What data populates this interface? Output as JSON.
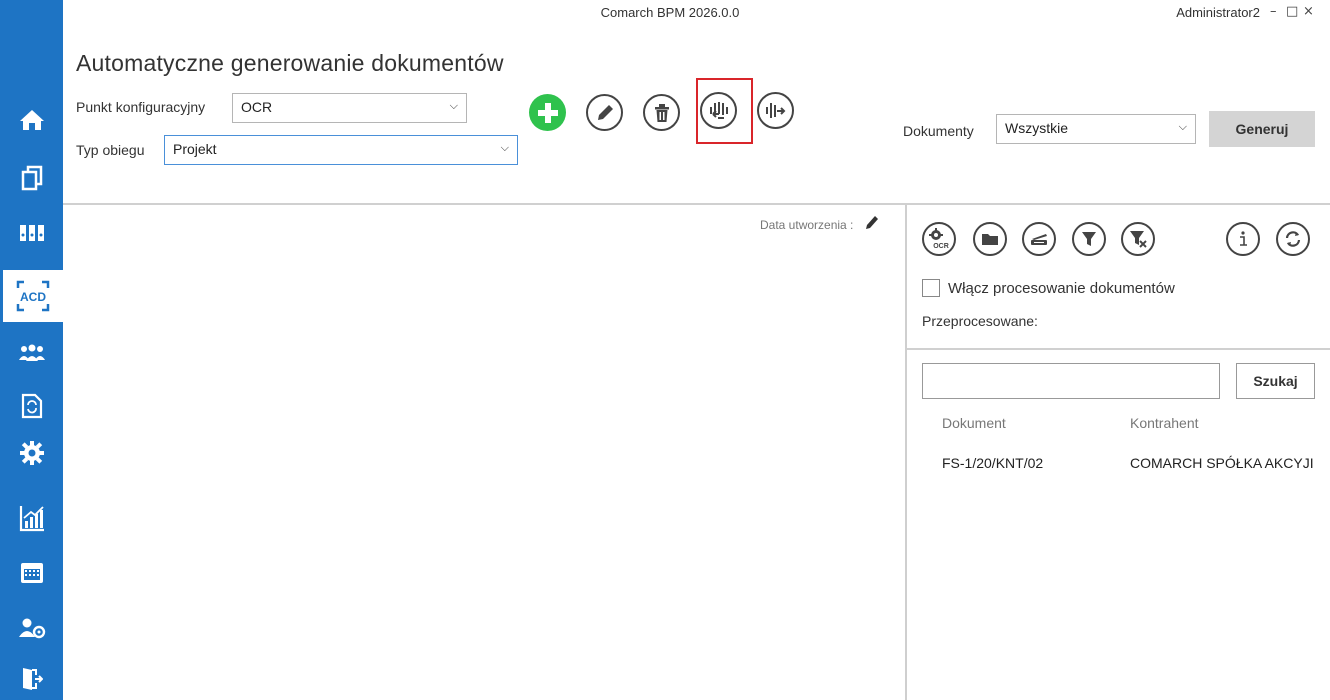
{
  "window": {
    "title": "Comarch BPM 2026.0.0",
    "user": "Administrator2",
    "controls": {
      "minimize": "–",
      "maximize": "□",
      "close": "×"
    }
  },
  "sidebar": {
    "items": [
      {
        "icon": "home-icon"
      },
      {
        "icon": "documents-icon"
      },
      {
        "icon": "binders-icon"
      },
      {
        "icon": "acd-icon",
        "label": "ACD",
        "active": true
      },
      {
        "icon": "users-icon"
      },
      {
        "icon": "document-exchange-icon"
      },
      {
        "icon": "gear-icon"
      },
      {
        "icon": "chart-icon"
      },
      {
        "icon": "calendar-icon"
      },
      {
        "icon": "user-settings-icon"
      },
      {
        "icon": "exit-icon"
      }
    ]
  },
  "page": {
    "title": "Automatyczne generowanie dokumentów"
  },
  "config": {
    "punkt_label": "Punkt konfiguracyjny",
    "punkt_value": "OCR",
    "typ_label": "Typ obiegu",
    "typ_value": "Projekt"
  },
  "toolbar": {
    "buttons": [
      "add-icon",
      "edit-icon",
      "delete-icon",
      "import-icon",
      "export-icon"
    ]
  },
  "documents": {
    "label": "Dokumenty",
    "value": "Wszystkie",
    "generate_label": "Generuj"
  },
  "list": {
    "date_label": "Data utworzenia :"
  },
  "right_panel": {
    "icons": [
      "ocr-settings-icon",
      "folder-icon",
      "scanner-icon",
      "filter-icon",
      "clear-filter-icon",
      "info-icon",
      "refresh-icon"
    ],
    "checkbox_label": "Włącz procesowanie dokumentów",
    "processed_label": "Przeprocesowane:",
    "search_button": "Szukaj",
    "columns": [
      "Dokument",
      "Kontrahent"
    ],
    "rows": [
      {
        "dokument": "FS-1/20/KNT/02",
        "kontrahent": "COMARCH SPÓŁKA AKCYJI"
      }
    ]
  },
  "colors": {
    "sidebar": "#1e74c4",
    "add_button": "#2fc24d",
    "highlight": "#d9252a"
  }
}
